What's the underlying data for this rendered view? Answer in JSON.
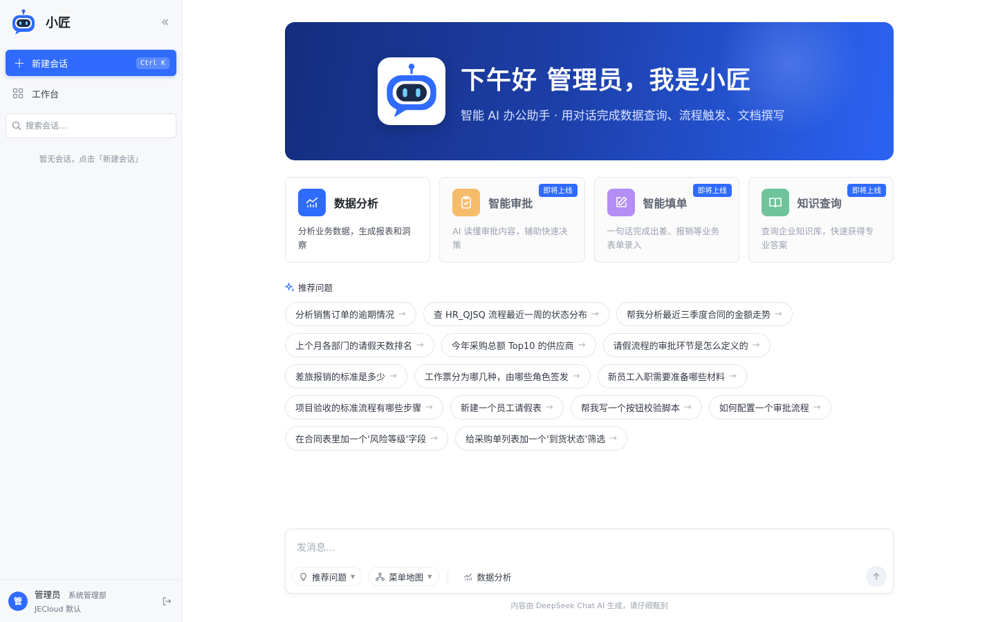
{
  "sidebar": {
    "brand_name": "小匠",
    "new_chat_label": "新建会话",
    "new_chat_shortcut": "Ctrl K",
    "workbench_label": "工作台",
    "search_placeholder": "搜索会话...",
    "empty_tip": "暂无会话，点击「新建会话」",
    "user": {
      "avatar_text": "管",
      "name": "管理员",
      "separator": "·",
      "role": "系统管理部",
      "org": "JECloud 默认"
    }
  },
  "hero": {
    "title": "下午好 管理员，我是小匠",
    "subtitle": "智能 AI 办公助手 · 用对话完成数据查询、流程触发、文档撰写"
  },
  "cards": [
    {
      "title": "数据分析",
      "desc": "分析业务数据，生成报表和洞察",
      "badge": "",
      "icon": "chart-icon",
      "color": "#2f6bff"
    },
    {
      "title": "智能审批",
      "desc": "AI 读懂审批内容，辅助快速决策",
      "badge": "即将上线",
      "icon": "clipboard-check-icon",
      "color": "#f5bd6a"
    },
    {
      "title": "智能填单",
      "desc": "一句话完成出差、报销等业务表单录入",
      "badge": "即将上线",
      "icon": "edit-icon",
      "color": "#b48ef5"
    },
    {
      "title": "知识查询",
      "desc": "查询企业知识库，快速获得专业答案",
      "badge": "即将上线",
      "icon": "book-icon",
      "color": "#6fc49b"
    }
  ],
  "recommend": {
    "title": "推荐问题",
    "rows": [
      [
        "分析销售订单的逾期情况",
        "查 HR_QJSQ 流程最近一周的状态分布",
        "帮我分析最近三季度合同的金额走势"
      ],
      [
        "上个月各部门的请假天数排名",
        "今年采购总额 Top10 的供应商",
        "请假流程的审批环节是怎么定义的"
      ],
      [
        "差旅报销的标准是多少",
        "工作票分为哪几种，由哪些角色签发",
        "新员工入职需要准备哪些材料"
      ],
      [
        "项目验收的标准流程有哪些步骤",
        "新建一个员工请假表",
        "帮我写一个按钮校验脚本",
        "如何配置一个审批流程"
      ],
      [
        "在合同表里加一个'风险等级'字段",
        "给采购单列表加一个'到货状态'筛选"
      ]
    ]
  },
  "composer": {
    "placeholder": "发消息...",
    "tool_recommend": "推荐问题",
    "tool_menu_map": "菜单地图",
    "tool_data_analysis": "数据分析"
  },
  "footnote": "内容由 DeepSeek Chat AI 生成，请仔细甄别"
}
